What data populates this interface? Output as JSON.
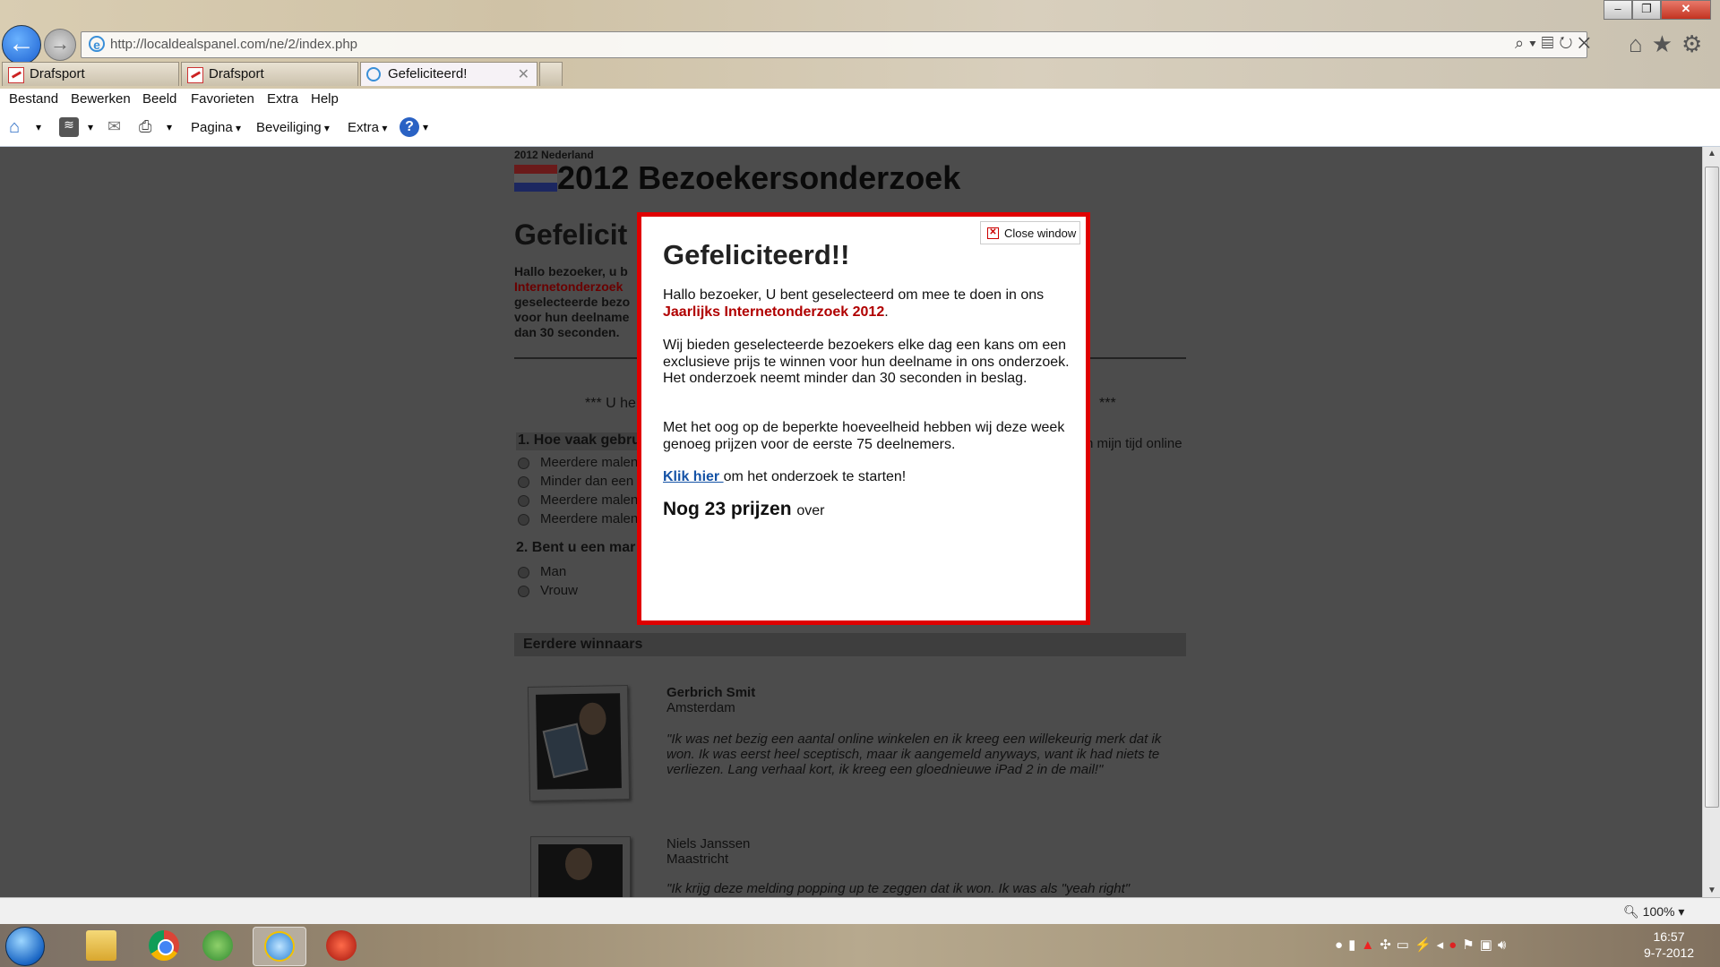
{
  "browser": {
    "url": "http://localdealspanel.com/ne/2/index.php",
    "tabs": [
      {
        "label": "Drafsport"
      },
      {
        "label": "Drafsport"
      },
      {
        "label": "Gefeliciteerd!"
      }
    ],
    "menu": [
      "Bestand",
      "Bewerken",
      "Beeld",
      "Favorieten",
      "Extra",
      "Help"
    ],
    "commandbar": {
      "page": "Pagina",
      "security": "Beveiliging",
      "extra": "Extra"
    },
    "zoom": "100%"
  },
  "page": {
    "subheading": "2012 Nederland",
    "title": "2012 Bezoekersonderzoek",
    "background_heading": "Gefelicit",
    "intro_lines": [
      "Hallo bezoeker, u b",
      "Internetonderzoek",
      "geselecteerde bezo",
      "voor hun deelname",
      "dan 30 seconden."
    ],
    "banner_left": "*** U he",
    "banner_right": "***",
    "question1": "1. Hoe vaak gebru",
    "question1_right": "n mijn tijd online",
    "question1_options": [
      "Meerdere malen",
      "Minder dan een",
      "Meerdere malen",
      "Meerdere malen"
    ],
    "question2": "2. Bent u een mar",
    "question2_options": [
      "Man",
      "Vrouw"
    ],
    "winners_title": "Eerdere winnaars",
    "winners": [
      {
        "name": "Gerbrich Smit",
        "city": "Amsterdam",
        "quote": "\"Ik was net bezig een aantal online winkelen en ik kreeg een willekeurig merk dat ik won. Ik was eerst heel sceptisch, maar ik aangemeld anyways, want ik had niets te verliezen. Lang verhaal kort, ik kreeg een gloednieuwe iPad 2 in de mail!\""
      },
      {
        "name": "Niels Janssen",
        "city": "Maastricht",
        "quote": "\"Ik krijg deze melding popping up te zeggen dat ik won. Ik was als \"yeah right\""
      }
    ]
  },
  "modal": {
    "close_label": "Close window",
    "title": "Gefeliciteerd!!",
    "p1_text": "Hallo bezoeker, U bent geselecteerd om mee te doen in ons",
    "p1_red": "Jaarlijks Internetonderzoek 2012",
    "p1_end": ".",
    "p2": "Wij bieden geselecteerde bezoekers elke dag een kans om een exclusieve prijs te winnen voor hun deelname in ons onderzoek. Het onderzoek neemt minder dan 30 seconden in beslag.",
    "p3": "Met het oog op de beperkte hoeveelheid hebben wij deze week genoeg prijzen voor de eerste 75 deelnemers.",
    "link": "Klik hier ",
    "link_after": "om het onderzoek te starten!",
    "prizes_bold": "Nog 23 prijzen",
    "prizes_after": "over"
  },
  "taskbar": {
    "time": "16:57",
    "date": "9-7-2012"
  },
  "colors": {
    "modal_border": "#e00000",
    "red_text": "#b00000",
    "link": "#1452a6"
  }
}
